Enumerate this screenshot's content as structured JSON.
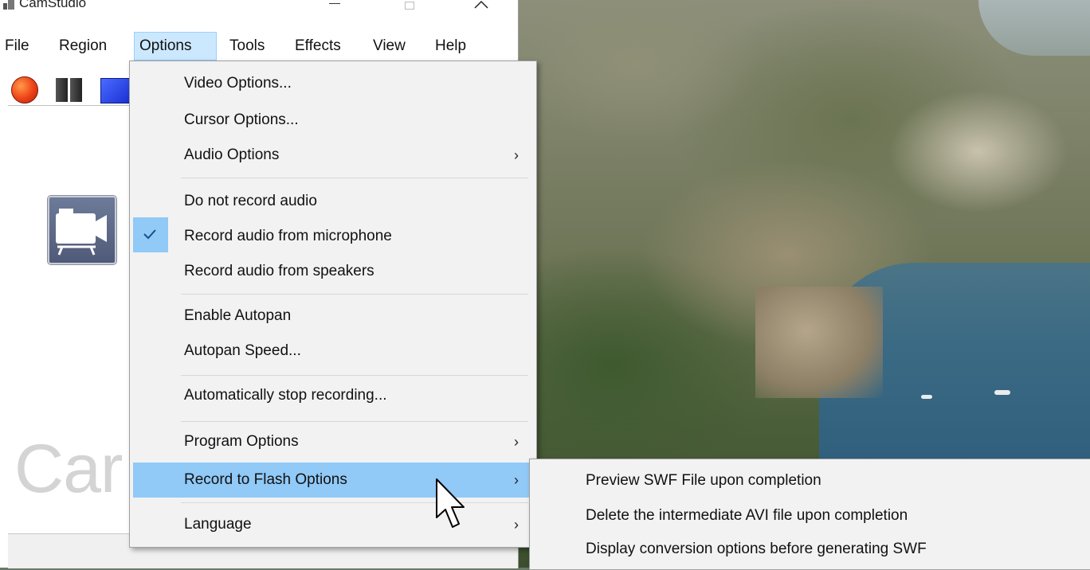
{
  "window": {
    "title": "CamStudio",
    "brand_watermark": "Car"
  },
  "menubar": {
    "items": [
      "File",
      "Region",
      "Options",
      "Tools",
      "Effects",
      "View",
      "Help"
    ],
    "active": "Options"
  },
  "toolbar": {
    "buttons": [
      "record-icon",
      "pause-icon",
      "stop-icon"
    ]
  },
  "options_menu": {
    "video_options": "Video Options...",
    "cursor_options": "Cursor Options...",
    "audio_options": "Audio Options",
    "do_not_record_audio": "Do not record audio",
    "record_audio_microphone": "Record audio from microphone",
    "record_audio_speakers": "Record audio from speakers",
    "enable_autopan": "Enable Autopan",
    "autopan_speed": "Autopan Speed...",
    "auto_stop": "Automatically stop recording...",
    "program_options": "Program Options",
    "record_to_flash": "Record to Flash Options",
    "language": "Language",
    "checked_item": "Record audio from microphone",
    "highlighted_item": "Record to Flash Options",
    "submenu_arrow": "›"
  },
  "flash_submenu": {
    "preview_swf": "Preview SWF File upon completion",
    "delete_avi": "Delete the intermediate AVI file upon completion",
    "display_conversion": "Display conversion options before generating SWF"
  },
  "colors": {
    "highlight": "#91c9f7",
    "active_menu": "#cce8ff",
    "menu_bg": "#f2f2f2"
  }
}
